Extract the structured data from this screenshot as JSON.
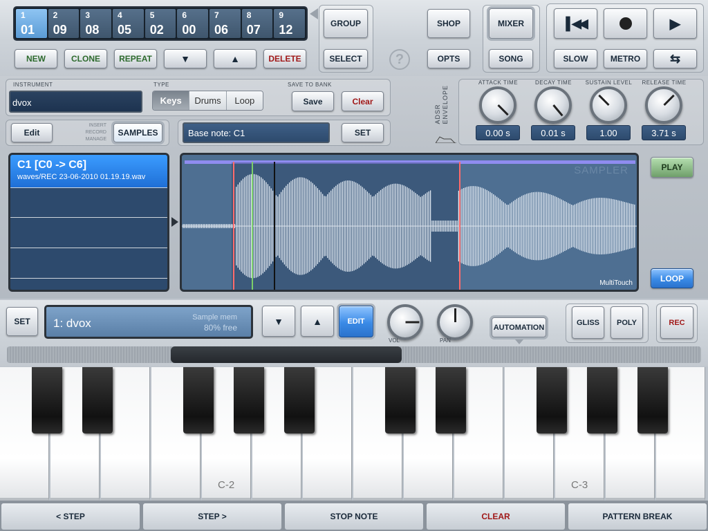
{
  "patterns": [
    {
      "num": "1",
      "val": "01",
      "active": true
    },
    {
      "num": "2",
      "val": "09"
    },
    {
      "num": "3",
      "val": "08"
    },
    {
      "num": "4",
      "val": "05"
    },
    {
      "num": "5",
      "val": "02"
    },
    {
      "num": "6",
      "val": "00"
    },
    {
      "num": "7",
      "val": "06"
    },
    {
      "num": "8",
      "val": "07"
    },
    {
      "num": "9",
      "val": "12"
    }
  ],
  "toolbar": {
    "new": "NEW",
    "clone": "CLONE",
    "repeat": "REPEAT",
    "delete": "DELETE",
    "group": "GROUP",
    "select": "SELECT",
    "help": "?",
    "shop": "SHOP",
    "opts": "OPTS",
    "mixer": "MIXER",
    "song": "SONG",
    "slow": "SLOW",
    "metro": "METRO"
  },
  "instrument": {
    "label": "INSTRUMENT",
    "name": "dvox",
    "type_label": "TYPE",
    "types": [
      "Keys",
      "Drums",
      "Loop"
    ],
    "selected_type": "Keys",
    "save_label": "SAVE TO BANK",
    "save": "Save",
    "clear": "Clear",
    "edit": "Edit",
    "modes": [
      "INSERT",
      "RECORD",
      "MANAGE"
    ],
    "samples": "SAMPLES",
    "base_note": "Base note: C1",
    "set": "SET"
  },
  "adsr": {
    "title_line1": "ADSR",
    "title_line2": "ENVELOPE",
    "knobs": [
      {
        "label": "ATTACK TIME",
        "value": "0.00 s",
        "angle": -45
      },
      {
        "label": "DECAY TIME",
        "value": "0.01 s",
        "angle": -40
      },
      {
        "label": "SUSTAIN LEVEL",
        "value": "1.00",
        "angle": 135
      },
      {
        "label": "RELEASE TIME",
        "value": "3.71 s",
        "angle": 225
      }
    ]
  },
  "sample": {
    "title": "C1 [C0 -> C6]",
    "file": "waves/REC 23-06-2010 01.19.19.wav",
    "watermark": "SAMPLER",
    "multitouch": "MultiTouch",
    "play": "PLAY",
    "loop": "LOOP"
  },
  "track": {
    "set": "SET",
    "name": "1: dvox",
    "mem_label": "Sample mem",
    "mem_value": "80% free",
    "edit": "EDIT",
    "vol": "VOL",
    "pan": "PAN",
    "automation": "AUTOMATION",
    "gliss": "GLISS",
    "poly": "POLY",
    "rec": "REC"
  },
  "keyboard": {
    "labels": [
      "C-2",
      "C-3"
    ]
  },
  "bottom": {
    "step_back": "< STEP",
    "step_fwd": "STEP >",
    "stop_note": "STOP NOTE",
    "clear": "CLEAR",
    "pattern_break": "PATTERN BREAK"
  },
  "colors": {
    "accent": "#3a8ae6",
    "rec": "#a01818",
    "play": "#6f9f6a"
  }
}
